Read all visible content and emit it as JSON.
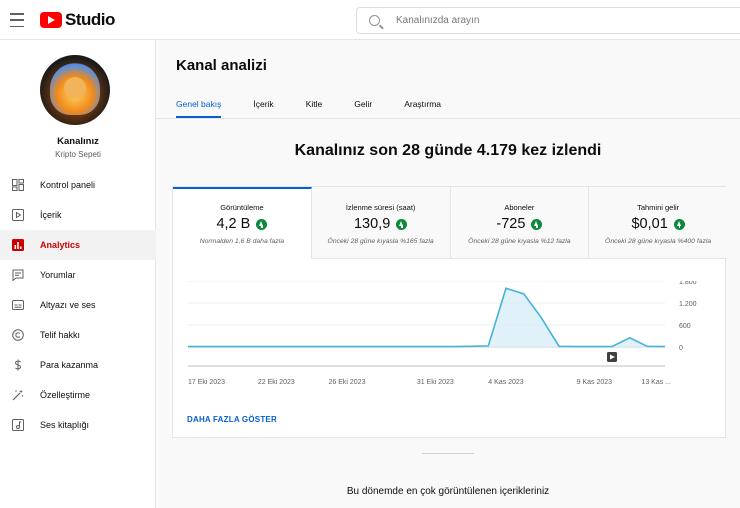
{
  "header": {
    "logo_text": "Studio",
    "search_placeholder": "Kanalınızda arayın"
  },
  "sidebar": {
    "channel_title": "Kanalınız",
    "channel_name": "Kripto Sepeti",
    "items": [
      {
        "label": "Kontrol paneli",
        "icon": "dashboard-icon",
        "active": false
      },
      {
        "label": "İçerik",
        "icon": "content-icon",
        "active": false
      },
      {
        "label": "Analytics",
        "icon": "analytics-icon",
        "active": true
      },
      {
        "label": "Yorumlar",
        "icon": "comments-icon",
        "active": false
      },
      {
        "label": "Altyazı ve ses",
        "icon": "subtitles-icon",
        "active": false
      },
      {
        "label": "Telif hakkı",
        "icon": "copyright-icon",
        "active": false
      },
      {
        "label": "Para kazanma",
        "icon": "dollar-icon",
        "active": false
      },
      {
        "label": "Özelleştirme",
        "icon": "magic-wand-icon",
        "active": false
      },
      {
        "label": "Ses kitaplığı",
        "icon": "audio-library-icon",
        "active": false
      }
    ]
  },
  "main": {
    "title": "Kanal analizi",
    "tabs": [
      {
        "label": "Genel bakış",
        "active": true
      },
      {
        "label": "İçerik",
        "active": false
      },
      {
        "label": "Kitle",
        "active": false
      },
      {
        "label": "Gelir",
        "active": false
      },
      {
        "label": "Araştırma",
        "active": false
      }
    ],
    "headline": "Kanalınız son 28 günde 4.179 kez izlendi",
    "metrics": [
      {
        "title": "Görüntüleme",
        "value": "4,2 B",
        "note": "Normalden 1,6 B daha fazla",
        "active": true
      },
      {
        "title": "İzlenme süresi (saat)",
        "value": "130,9",
        "note": "Önceki 28 güne kıyasla %165 fazla",
        "active": false
      },
      {
        "title": "Aboneler",
        "value": "-725",
        "note": "Önceki 28 güne kıyasla %12 fazla",
        "active": false
      },
      {
        "title": "Tahmini gelir",
        "value": "$0,01",
        "note": "Önceki 28 güne kıyasla %400 fazla",
        "active": false
      }
    ],
    "show_more": "DAHA FAZLA GÖSTER",
    "top_content_title": "Bu dönemde en çok görüntülenen içerikleriniz"
  },
  "colors": {
    "accent": "#065fd4",
    "active_nav": "#cc0000",
    "positive": "#0a8a3a",
    "line": "#41b4d8"
  },
  "chart_data": {
    "type": "area",
    "x_tick_labels": [
      "17 Eki 2023",
      "22 Eki 2023",
      "26 Eki 2023",
      "31 Eki 2023",
      "4 Kas 2023",
      "9 Kas 2023",
      "13 Kas ..."
    ],
    "y_tick_labels": [
      "1.800",
      "1.200",
      "600",
      "0"
    ],
    "y_ticks": [
      1800,
      1200,
      600,
      0
    ],
    "ylim": [
      0,
      1800
    ],
    "x": [
      "17 Eki",
      "18 Eki",
      "19 Eki",
      "20 Eki",
      "21 Eki",
      "22 Eki",
      "23 Eki",
      "24 Eki",
      "25 Eki",
      "26 Eki",
      "27 Eki",
      "28 Eki",
      "29 Eki",
      "30 Eki",
      "31 Eki",
      "1 Kas",
      "2 Kas",
      "3 Kas",
      "4 Kas",
      "5 Kas",
      "6 Kas",
      "7 Kas",
      "8 Kas",
      "9 Kas",
      "10 Kas",
      "11 Kas",
      "12 Kas",
      "13 Kas"
    ],
    "series": [
      {
        "values": [
          10,
          10,
          10,
          10,
          10,
          10,
          10,
          10,
          10,
          10,
          10,
          10,
          10,
          10,
          10,
          10,
          20,
          30,
          1600,
          1450,
          800,
          20,
          10,
          10,
          10,
          250,
          20,
          10
        ]
      }
    ],
    "grid": true,
    "legend": "none"
  }
}
